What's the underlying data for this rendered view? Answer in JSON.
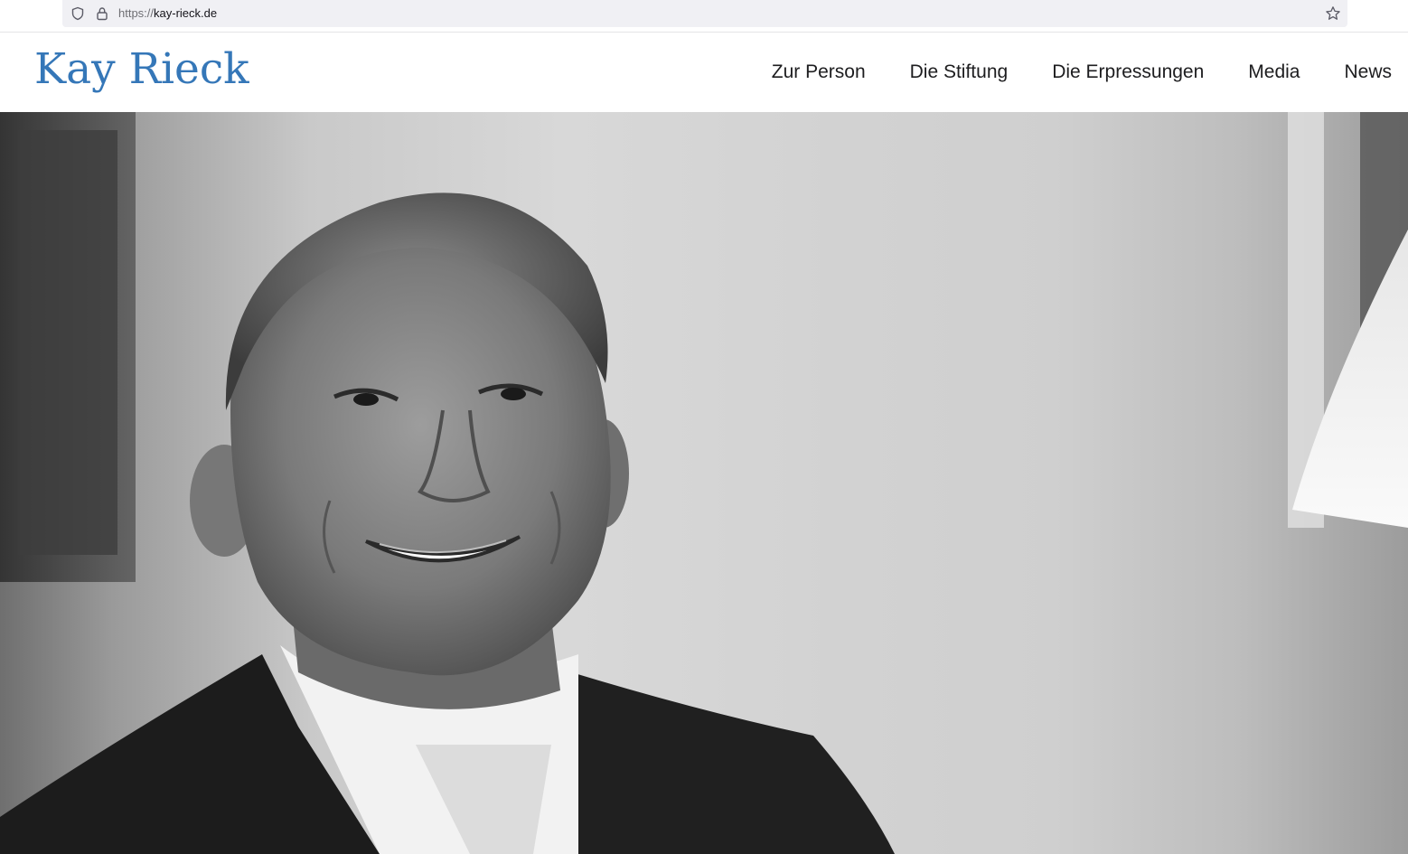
{
  "browser": {
    "url_scheme": "https://",
    "url_host": "kay-rieck.de",
    "icons": [
      "shield-icon",
      "lock-icon",
      "star-icon"
    ]
  },
  "header": {
    "logo_text": "Kay Rieck",
    "logo_color": "#3577b8"
  },
  "nav": {
    "items": [
      {
        "label": "Zur Person"
      },
      {
        "label": "Die Stiftung"
      },
      {
        "label": "Die Erpressungen"
      },
      {
        "label": "Media"
      },
      {
        "label": "News"
      }
    ]
  },
  "hero": {
    "image": "black-and-white portrait photo"
  }
}
